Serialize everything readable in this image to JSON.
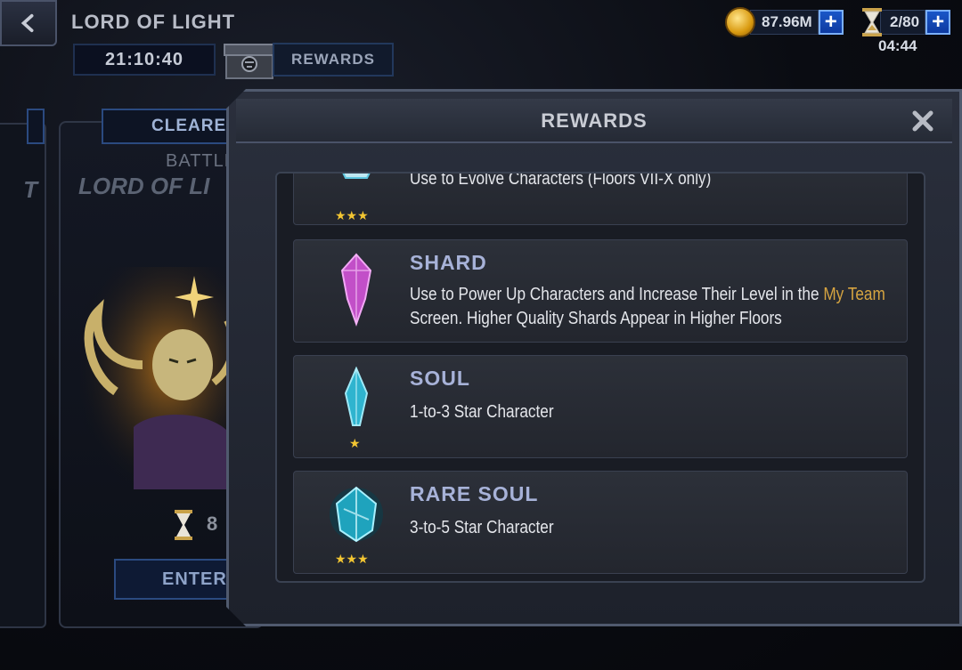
{
  "header": {
    "title": "LORD OF LIGHT",
    "timer": "21:10:40",
    "rewards_label": "REWARDS"
  },
  "currency": {
    "gold": "87.96M",
    "plus": "+",
    "energy": "2/80",
    "energy_timer": "04:44"
  },
  "card": {
    "cleared_label": "CLEARE",
    "battle_label": "BATTLE",
    "boss_name": "LORD OF LI",
    "side_letter": "T",
    "hourglass_value": "8",
    "enter_label": "ENTER"
  },
  "modal": {
    "title": "REWARDS",
    "items": [
      {
        "name": "",
        "desc": "Use to Evolve Characters (Floors VII-X only)",
        "stars": "★★★",
        "icon": "crystal-icon"
      },
      {
        "name": "SHARD",
        "desc_a": "Use to Power Up Characters and Increase Their Level in the ",
        "desc_hl": "My Team",
        "desc_b": " Screen. Higher Quality Shards Appear in Higher Floors",
        "stars": "",
        "icon": "shard-icon"
      },
      {
        "name": "SOUL",
        "desc": "1-to-3 Star Character",
        "stars": "★",
        "icon": "soul-icon"
      },
      {
        "name": "RARE SOUL",
        "desc": "3-to-5 Star Character",
        "stars": "★★★",
        "icon": "rare-soul-icon"
      }
    ]
  },
  "colors": {
    "accent_blue": "#2b4a80",
    "gold": "#f3c632",
    "highlight": "#d6a441",
    "item_title": "#a7b2d8"
  }
}
